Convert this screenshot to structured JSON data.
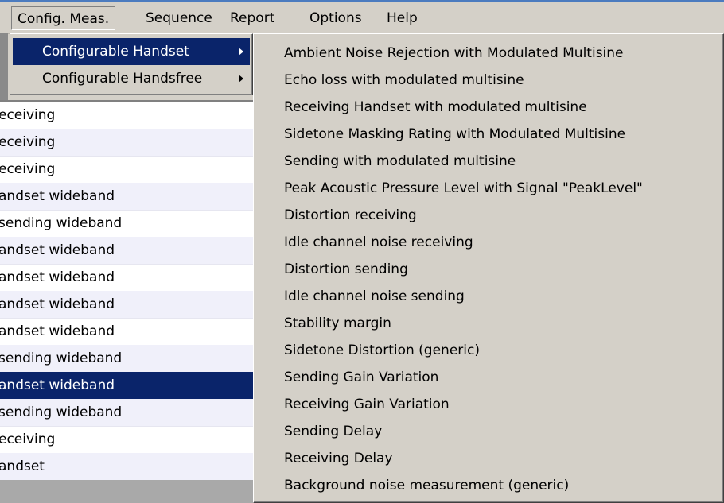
{
  "menubar": {
    "items": [
      "Config. Meas.",
      "Sequence",
      "Report",
      "Options",
      "Help"
    ]
  },
  "submenu": {
    "items": [
      "Configurable Handset",
      "Configurable Handsfree"
    ]
  },
  "handset_menu": {
    "items": [
      "Ambient Noise Rejection with Modulated Multisine",
      "Echo loss with modulated multisine",
      "Receiving Handset with modulated multisine",
      "Sidetone Masking Rating with Modulated Multisine",
      "Sending with modulated multisine",
      "Peak Acoustic Pressure Level with Signal \"PeakLevel\"",
      "Distortion receiving",
      "Idle channel noise receiving",
      "Distortion sending",
      "Idle channel noise sending",
      "Stability margin",
      "Sidetone Distortion (generic)",
      "Sending Gain Variation",
      "Receiving Gain Variation",
      "Sending Delay",
      "Receiving Delay",
      "Background noise measurement (generic)"
    ]
  },
  "list": {
    "rows": [
      "eceiving",
      "eceiving",
      "eceiving",
      "andset wideband",
      "sending wideband",
      "andset wideband",
      "andset wideband",
      "andset wideband",
      "andset wideband",
      "sending wideband",
      "andset wideband",
      "sending wideband",
      "eceiving",
      "andset"
    ]
  },
  "colors": {
    "selection": "#0a246a",
    "menu_bg": "#d4d0c8"
  }
}
